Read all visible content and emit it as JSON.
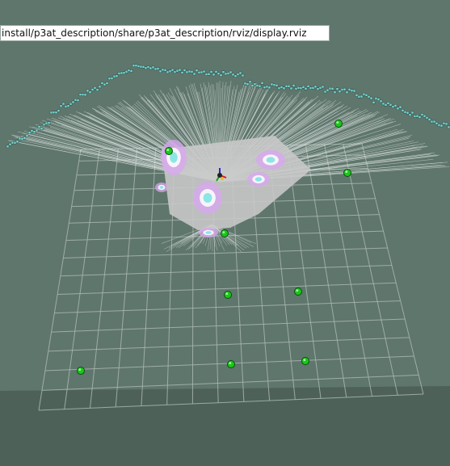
{
  "window": {
    "config_path": "install/p3at_description/share/p3at_description/rviz/display.rviz"
  },
  "scene": {
    "background_color": "#5f766c",
    "ground_color": "#4e6158",
    "grid_color": "#a9b7b0",
    "laser_color": "#e6ebea",
    "map_free_color": "#c8c8c8",
    "map_wall_color": "#7de6e0",
    "costmap_halo_color": "#d9a6f2",
    "marker_color": "#19c919",
    "robot_icon": "robot-axes-icon",
    "marker_icon": "sphere-marker-icon",
    "markers": [
      {
        "id": "marker-1"
      },
      {
        "id": "marker-2"
      },
      {
        "id": "marker-3"
      },
      {
        "id": "marker-4"
      },
      {
        "id": "marker-5"
      },
      {
        "id": "marker-6"
      },
      {
        "id": "marker-7"
      },
      {
        "id": "marker-8"
      },
      {
        "id": "marker-9"
      }
    ]
  }
}
